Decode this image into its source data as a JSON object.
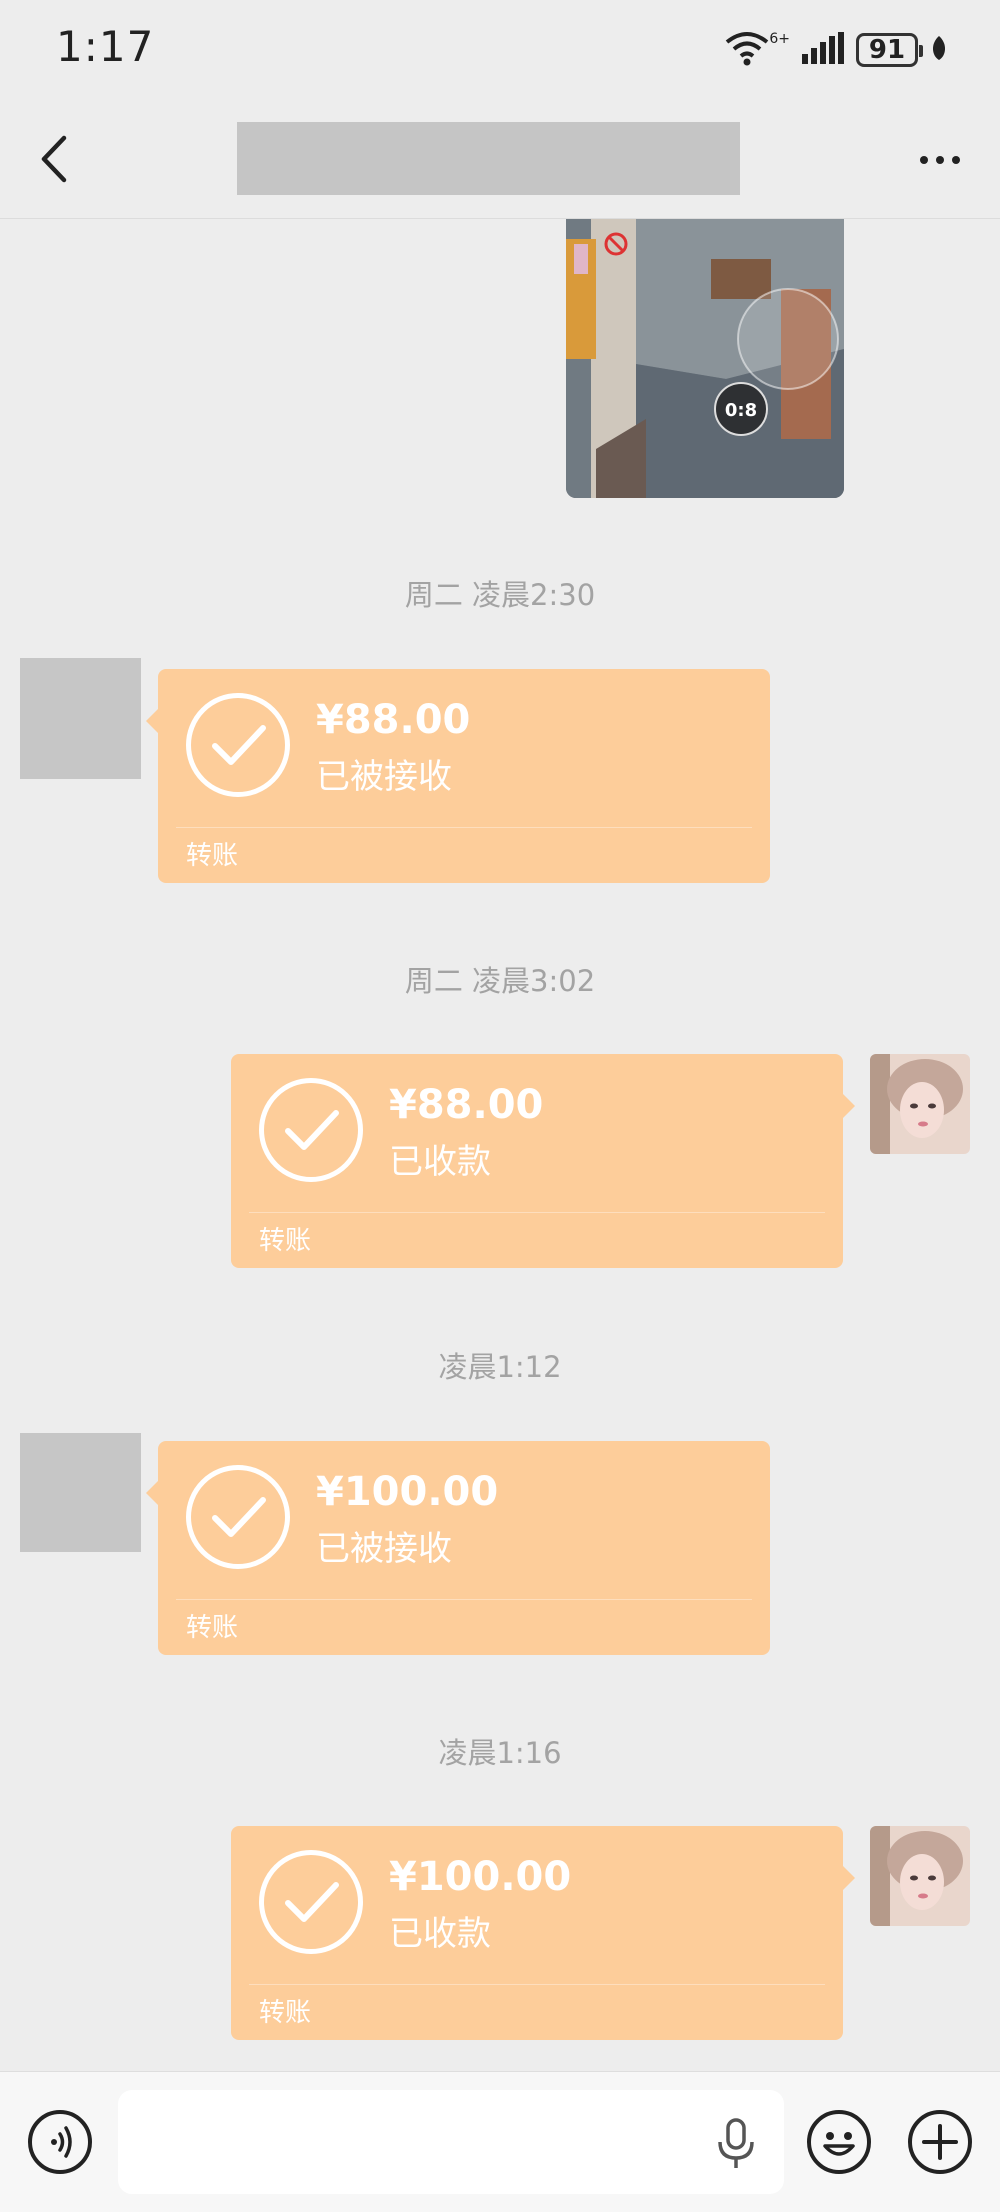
{
  "status_bar": {
    "time": "1:17",
    "network_label": "6+",
    "battery": "91"
  },
  "nav": {
    "back_icon": "chevron-left-icon",
    "more_icon": "more-dots-icon"
  },
  "messages": [
    {
      "timestamp": "周二 凌晨2:30",
      "side": "left",
      "amount": "¥88.00",
      "status": "已被接收",
      "label": "转账"
    },
    {
      "timestamp": "周二 凌晨3:02",
      "side": "right",
      "amount": "¥88.00",
      "status": "已收款",
      "label": "转账"
    },
    {
      "timestamp": "凌晨1:12",
      "side": "left",
      "amount": "¥100.00",
      "status": "已被接收",
      "label": "转账"
    },
    {
      "timestamp": "凌晨1:16",
      "side": "right",
      "amount": "¥100.00",
      "status": "已收款",
      "label": "转账"
    }
  ],
  "game_image": {
    "timer_text": "0:8"
  },
  "input_bar": {
    "voice_icon": "voice-icon",
    "mic_icon": "mic-icon",
    "emoji_icon": "emoji-icon",
    "add_icon": "plus-icon",
    "message_value": ""
  },
  "colors": {
    "bubble": "#fdcd9a",
    "background": "#ededed"
  }
}
